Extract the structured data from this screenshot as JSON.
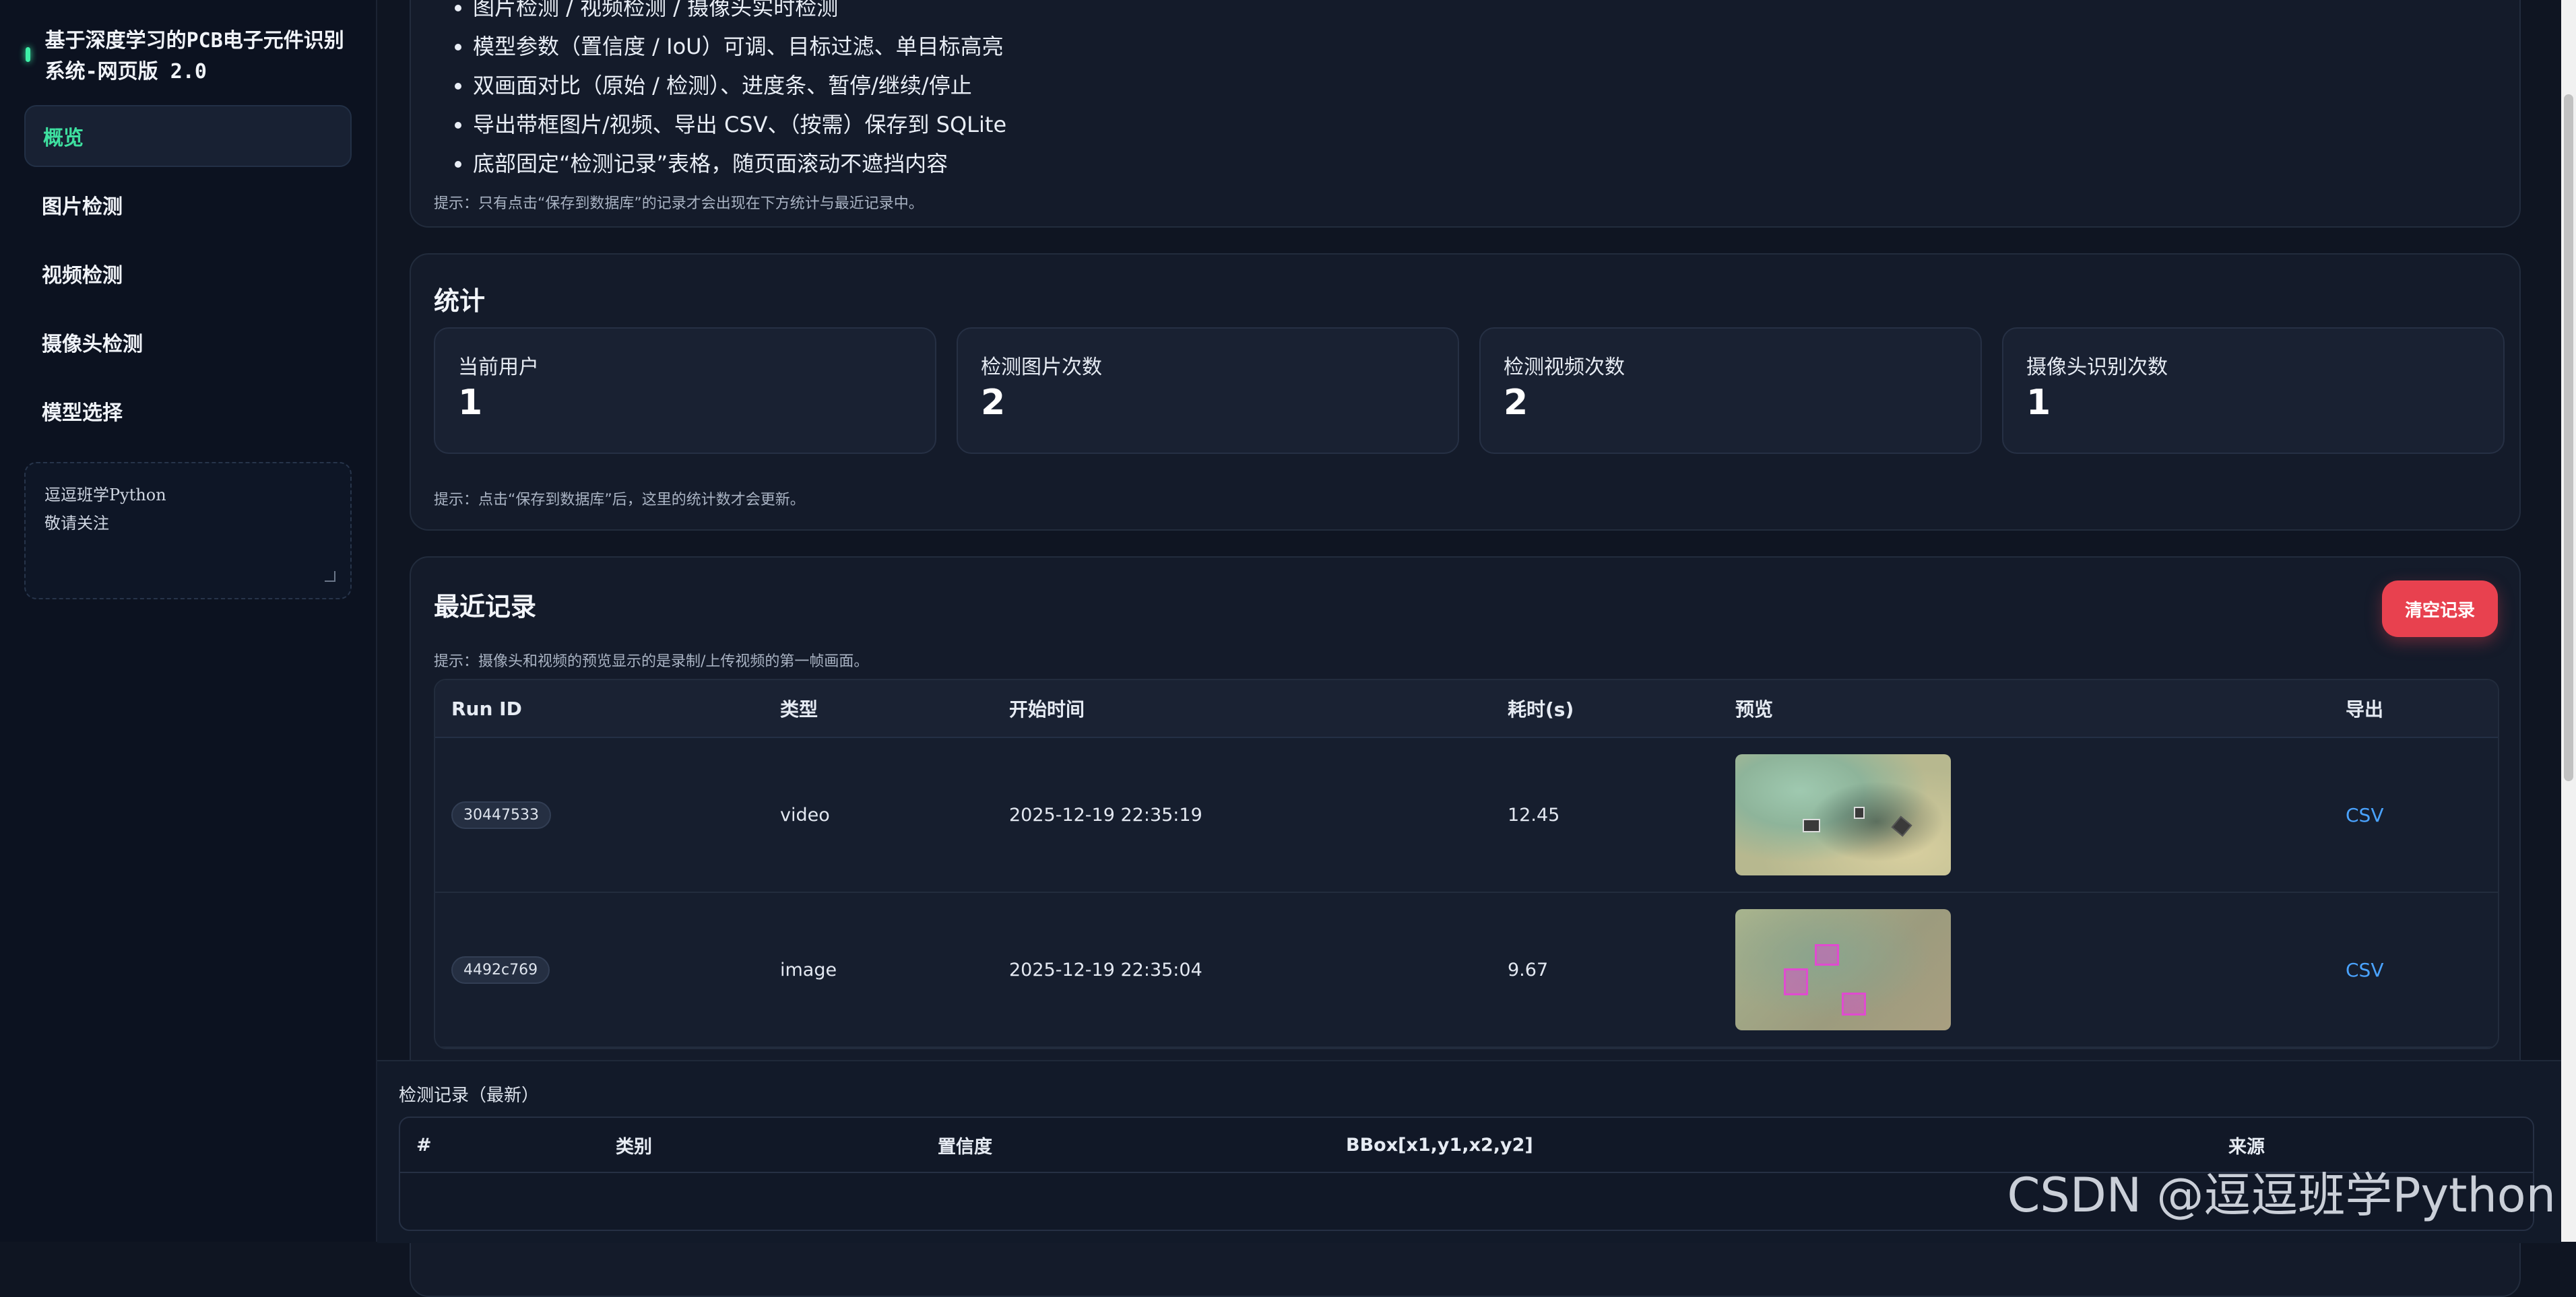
{
  "sidebar": {
    "title": "基于深度学习的PCB电子元件识别系统-网页版 2.0",
    "nav": [
      "概览",
      "图片检测",
      "视频检测",
      "摄像头检测",
      "模型选择"
    ],
    "note": "逗逗班学Python\n敬请关注"
  },
  "intro": {
    "bullets": [
      "图片检测 / 视频检测 / 摄像头实时检测",
      "模型参数（置信度 / IoU）可调、目标过滤、单目标高亮",
      "双画面对比（原始 / 检测）、进度条、暂停/继续/停止",
      "导出带框图片/视频、导出 CSV、（按需）保存到 SQLite",
      "底部固定“检测记录”表格，随页面滚动不遮挡内容"
    ],
    "hint": "提示：只有点击“保存到数据库”的记录才会出现在下方统计与最近记录中。"
  },
  "stats": {
    "title": "统计",
    "items": [
      {
        "label": "当前用户",
        "value": "1"
      },
      {
        "label": "检测图片次数",
        "value": "2"
      },
      {
        "label": "检测视频次数",
        "value": "2"
      },
      {
        "label": "摄像头识别次数",
        "value": "1"
      }
    ],
    "hint": "提示：点击“保存到数据库”后，这里的统计数才会更新。"
  },
  "records": {
    "title": "最近记录",
    "clear_label": "清空记录",
    "hint": "提示：摄像头和视频的预览显示的是录制/上传视频的第一帧画面。",
    "columns": [
      "Run ID",
      "类型",
      "开始时间",
      "耗时(s)",
      "预览",
      "导出"
    ],
    "rows": [
      {
        "run_id": "30447533",
        "type": "video",
        "start": "2025-12-19 22:35:19",
        "duration": "12.45",
        "export": "CSV"
      },
      {
        "run_id": "4492c769",
        "type": "image",
        "start": "2025-12-19 22:35:04",
        "duration": "9.67",
        "export": "CSV"
      }
    ]
  },
  "detections": {
    "title": "检测记录（最新）",
    "columns": [
      "#",
      "类别",
      "置信度",
      "BBox[x1,y1,x2,y2]",
      "来源"
    ]
  },
  "watermark": "CSDN @逗逗班学Python"
}
